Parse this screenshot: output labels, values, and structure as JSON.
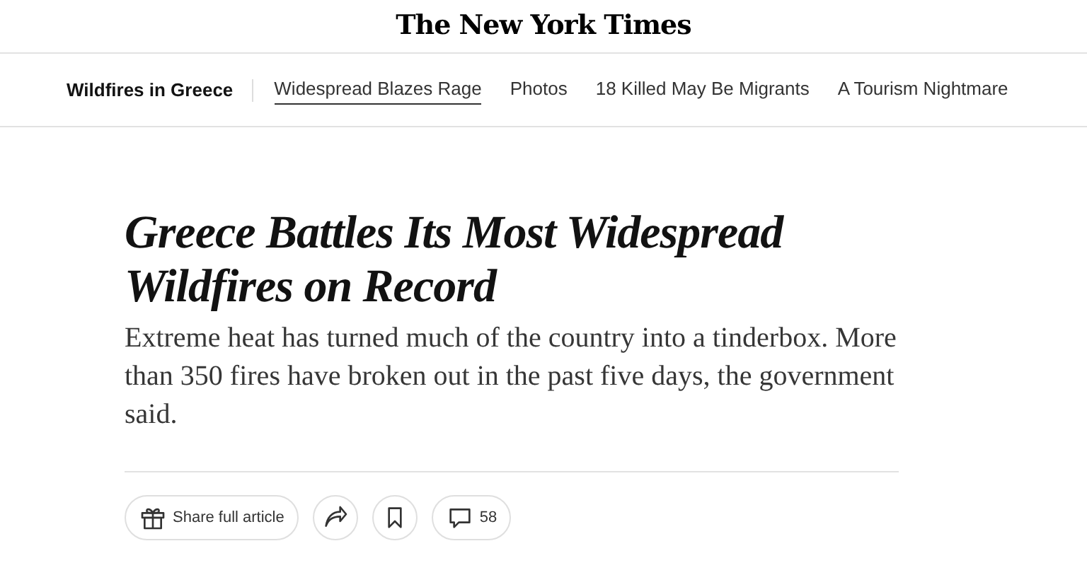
{
  "masthead": {
    "logo": "The New York Times"
  },
  "topic_nav": {
    "title": "Wildfires in Greece",
    "links": [
      {
        "label": "Widespread Blazes Rage",
        "selected": true
      },
      {
        "label": "Photos",
        "selected": false
      },
      {
        "label": "18 Killed May Be Migrants",
        "selected": false
      },
      {
        "label": "A Tourism Nightmare",
        "selected": false
      }
    ]
  },
  "article": {
    "headline": "Greece Battles Its Most Widespread Wildfires on Record",
    "summary": "Extreme heat has turned much of the country into a tinderbox. More than 350 fires have broken out in the past five days, the government said."
  },
  "actions": [
    {
      "kind": "gift",
      "label": "Share full article"
    },
    {
      "kind": "share"
    },
    {
      "kind": "save"
    },
    {
      "kind": "comments",
      "label": "58"
    }
  ]
}
